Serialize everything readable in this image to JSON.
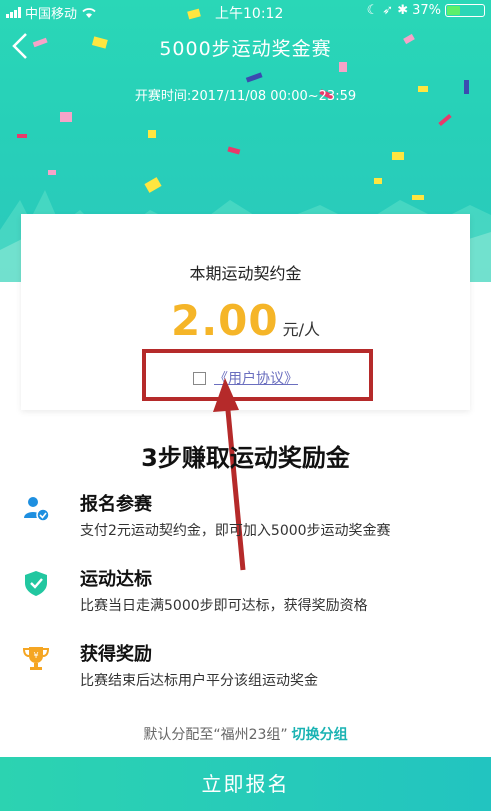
{
  "status_bar": {
    "carrier": "中国移动",
    "time": "上午10:12",
    "battery": "37%",
    "battery_level": 0.37
  },
  "header": {
    "title": "5000步运动奖金赛",
    "start_time": "开赛时间:2017/11/08 00:00~23:59"
  },
  "card": {
    "label": "本期运动契约金",
    "amount": "2.00",
    "unit": "元/人",
    "agreement_link": "《用户协议》"
  },
  "steps_section": {
    "title": "3步赚取运动奖励金",
    "steps": [
      {
        "icon": "person-check-icon",
        "title": "报名参赛",
        "desc": "支付2元运动契约金，即可加入5000步运动奖金赛"
      },
      {
        "icon": "shield-check-icon",
        "title": "运动达标",
        "desc": "比赛当日走满5000步即可达标，获得奖励资格"
      },
      {
        "icon": "trophy-icon",
        "title": "获得奖励",
        "desc": "比赛结束后达标用户平分该组运动奖金"
      }
    ]
  },
  "group": {
    "text": "默认分配至“福州23组”",
    "switch_label": "切换分组"
  },
  "register_button": "立即报名",
  "colors": {
    "accent": "#2ad7b7",
    "amount": "#f5b528",
    "highlight": "#b52a2a",
    "link": "#6b6fbf"
  }
}
